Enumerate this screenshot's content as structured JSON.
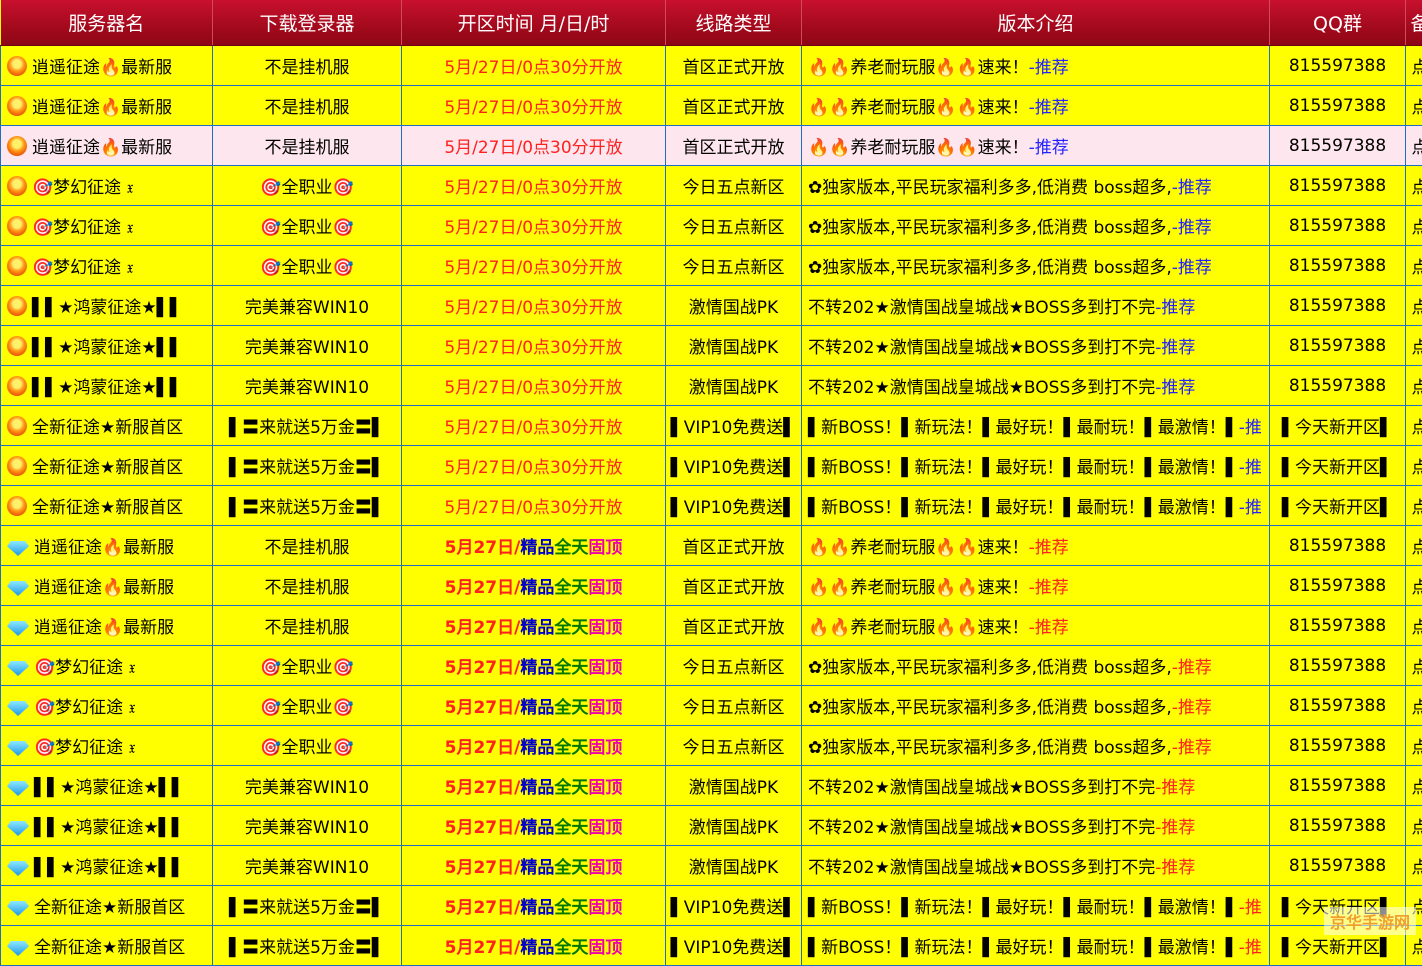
{
  "table": {
    "headers": [
      "服务器名",
      "下载登录器",
      "开区时间 月/日/时",
      "线路类型",
      "版本介绍",
      "QQ群",
      "备"
    ],
    "rows": [
      {
        "icon": "fire-icon",
        "name": "逍遥征途🔥最新服",
        "download": "不是挂机服",
        "open": "5月/27日/0点30分开放",
        "open_style": "a",
        "line": "首区正式开放",
        "desc": "🔥🔥养老耐玩服🔥🔥速来！",
        "rec": "-推荐",
        "rec_style": "b",
        "qq": "815597388",
        "extra": "点",
        "highlight": false
      },
      {
        "icon": "fire-icon",
        "name": "逍遥征途🔥最新服",
        "download": "不是挂机服",
        "open": "5月/27日/0点30分开放",
        "open_style": "a",
        "line": "首区正式开放",
        "desc": "🔥🔥养老耐玩服🔥🔥速来！",
        "rec": "-推荐",
        "rec_style": "b",
        "qq": "815597388",
        "extra": "点",
        "highlight": false
      },
      {
        "icon": "fire-icon",
        "name": "逍遥征途🔥最新服",
        "download": "不是挂机服",
        "open": "5月/27日/0点30分开放",
        "open_style": "a",
        "line": "首区正式开放",
        "desc": "🔥🔥养老耐玩服🔥🔥速来！",
        "rec": "-推荐",
        "rec_style": "b",
        "qq": "815597388",
        "extra": "点",
        "highlight": true
      },
      {
        "icon": "fire-icon",
        "name": "🎯梦幻征途 𝔵",
        "download": "🎯全职业🎯",
        "open": "5月/27日/0点30分开放",
        "open_style": "a",
        "line": "今日五点新区",
        "desc": "✿独家版本,平民玩家福利多多,低消费 boss超多,",
        "rec": "-推荐",
        "rec_style": "b",
        "qq": "815597388",
        "extra": "点",
        "highlight": false
      },
      {
        "icon": "fire-icon",
        "name": "🎯梦幻征途 𝔵",
        "download": "🎯全职业🎯",
        "open": "5月/27日/0点30分开放",
        "open_style": "a",
        "line": "今日五点新区",
        "desc": "✿独家版本,平民玩家福利多多,低消费 boss超多,",
        "rec": "-推荐",
        "rec_style": "b",
        "qq": "815597388",
        "extra": "点",
        "highlight": false
      },
      {
        "icon": "fire-icon",
        "name": "🎯梦幻征途 𝔵",
        "download": "🎯全职业🎯",
        "open": "5月/27日/0点30分开放",
        "open_style": "a",
        "line": "今日五点新区",
        "desc": "✿独家版本,平民玩家福利多多,低消费 boss超多,",
        "rec": "-推荐",
        "rec_style": "b",
        "qq": "815597388",
        "extra": "点",
        "highlight": false
      },
      {
        "icon": "fire-icon",
        "name": "▌▌★鸿蒙征途★▌▌",
        "download": "完美兼容WIN10",
        "open": "5月/27日/0点30分开放",
        "open_style": "a",
        "line": "激情国战PK",
        "desc": "不转202★激情国战皇城战★BOSS多到打不完",
        "rec": "-推荐",
        "rec_style": "b",
        "qq": "815597388",
        "extra": "点",
        "highlight": false
      },
      {
        "icon": "fire-icon",
        "name": "▌▌★鸿蒙征途★▌▌",
        "download": "完美兼容WIN10",
        "open": "5月/27日/0点30分开放",
        "open_style": "a",
        "line": "激情国战PK",
        "desc": "不转202★激情国战皇城战★BOSS多到打不完",
        "rec": "-推荐",
        "rec_style": "b",
        "qq": "815597388",
        "extra": "点",
        "highlight": false
      },
      {
        "icon": "fire-icon",
        "name": "▌▌★鸿蒙征途★▌▌",
        "download": "完美兼容WIN10",
        "open": "5月/27日/0点30分开放",
        "open_style": "a",
        "line": "激情国战PK",
        "desc": "不转202★激情国战皇城战★BOSS多到打不完",
        "rec": "-推荐",
        "rec_style": "b",
        "qq": "815597388",
        "extra": "点",
        "highlight": false
      },
      {
        "icon": "fire-icon",
        "name": "全新征途★新服首区",
        "download": "▌〓来就送5万金〓▌",
        "open": "5月/27日/0点30分开放",
        "open_style": "a",
        "line": "▌VIP10免费送▌",
        "desc": "▌新BOSS！▌新玩法！▌最好玩！▌最耐玩！▌最激情！▌",
        "rec": "-推",
        "rec_style": "b",
        "qq": "▌今天新开区▌",
        "extra": "点",
        "highlight": false
      },
      {
        "icon": "fire-icon",
        "name": "全新征途★新服首区",
        "download": "▌〓来就送5万金〓▌",
        "open": "5月/27日/0点30分开放",
        "open_style": "a",
        "line": "▌VIP10免费送▌",
        "desc": "▌新BOSS！▌新玩法！▌最好玩！▌最耐玩！▌最激情！▌",
        "rec": "-推",
        "rec_style": "b",
        "qq": "▌今天新开区▌",
        "extra": "点",
        "highlight": false
      },
      {
        "icon": "fire-icon",
        "name": "全新征途★新服首区",
        "download": "▌〓来就送5万金〓▌",
        "open": "5月/27日/0点30分开放",
        "open_style": "a",
        "line": "▌VIP10免费送▌",
        "desc": "▌新BOSS！▌新玩法！▌最好玩！▌最耐玩！▌最激情！▌",
        "rec": "-推",
        "rec_style": "b",
        "qq": "▌今天新开区▌",
        "extra": "点",
        "highlight": false
      },
      {
        "icon": "diamond-icon",
        "name": "逍遥征途🔥最新服",
        "download": "不是挂机服",
        "open": [
          "5月27日/",
          "精品",
          "全天",
          "固顶"
        ],
        "open_style": "b",
        "line": "首区正式开放",
        "desc": "🔥🔥养老耐玩服🔥🔥速来！",
        "rec": "-推荐",
        "rec_style": "r",
        "qq": "815597388",
        "extra": "点",
        "highlight": false
      },
      {
        "icon": "diamond-icon",
        "name": "逍遥征途🔥最新服",
        "download": "不是挂机服",
        "open": [
          "5月27日/",
          "精品",
          "全天",
          "固顶"
        ],
        "open_style": "b",
        "line": "首区正式开放",
        "desc": "🔥🔥养老耐玩服🔥🔥速来！",
        "rec": "-推荐",
        "rec_style": "r",
        "qq": "815597388",
        "extra": "点",
        "highlight": false
      },
      {
        "icon": "diamond-icon",
        "name": "逍遥征途🔥最新服",
        "download": "不是挂机服",
        "open": [
          "5月27日/",
          "精品",
          "全天",
          "固顶"
        ],
        "open_style": "b",
        "line": "首区正式开放",
        "desc": "🔥🔥养老耐玩服🔥🔥速来！",
        "rec": "-推荐",
        "rec_style": "r",
        "qq": "815597388",
        "extra": "点",
        "highlight": false
      },
      {
        "icon": "diamond-icon",
        "name": "🎯梦幻征途 𝔵",
        "download": "🎯全职业🎯",
        "open": [
          "5月27日/",
          "精品",
          "全天",
          "固顶"
        ],
        "open_style": "b",
        "line": "今日五点新区",
        "desc": "✿独家版本,平民玩家福利多多,低消费 boss超多,",
        "rec": "-推荐",
        "rec_style": "r",
        "qq": "815597388",
        "extra": "点",
        "highlight": false
      },
      {
        "icon": "diamond-icon",
        "name": "🎯梦幻征途 𝔵",
        "download": "🎯全职业🎯",
        "open": [
          "5月27日/",
          "精品",
          "全天",
          "固顶"
        ],
        "open_style": "b",
        "line": "今日五点新区",
        "desc": "✿独家版本,平民玩家福利多多,低消费 boss超多,",
        "rec": "-推荐",
        "rec_style": "r",
        "qq": "815597388",
        "extra": "点",
        "highlight": false
      },
      {
        "icon": "diamond-icon",
        "name": "🎯梦幻征途 𝔵",
        "download": "🎯全职业🎯",
        "open": [
          "5月27日/",
          "精品",
          "全天",
          "固顶"
        ],
        "open_style": "b",
        "line": "今日五点新区",
        "desc": "✿独家版本,平民玩家福利多多,低消费 boss超多,",
        "rec": "-推荐",
        "rec_style": "r",
        "qq": "815597388",
        "extra": "点",
        "highlight": false
      },
      {
        "icon": "diamond-icon",
        "name": "▌▌★鸿蒙征途★▌▌",
        "download": "完美兼容WIN10",
        "open": [
          "5月27日/",
          "精品",
          "全天",
          "固顶"
        ],
        "open_style": "b",
        "line": "激情国战PK",
        "desc": "不转202★激情国战皇城战★BOSS多到打不完",
        "rec": "-推荐",
        "rec_style": "r",
        "qq": "815597388",
        "extra": "点",
        "highlight": false
      },
      {
        "icon": "diamond-icon",
        "name": "▌▌★鸿蒙征途★▌▌",
        "download": "完美兼容WIN10",
        "open": [
          "5月27日/",
          "精品",
          "全天",
          "固顶"
        ],
        "open_style": "b",
        "line": "激情国战PK",
        "desc": "不转202★激情国战皇城战★BOSS多到打不完",
        "rec": "-推荐",
        "rec_style": "r",
        "qq": "815597388",
        "extra": "点",
        "highlight": false
      },
      {
        "icon": "diamond-icon",
        "name": "▌▌★鸿蒙征途★▌▌",
        "download": "完美兼容WIN10",
        "open": [
          "5月27日/",
          "精品",
          "全天",
          "固顶"
        ],
        "open_style": "b",
        "line": "激情国战PK",
        "desc": "不转202★激情国战皇城战★BOSS多到打不完",
        "rec": "-推荐",
        "rec_style": "r",
        "qq": "815597388",
        "extra": "点",
        "highlight": false
      },
      {
        "icon": "diamond-icon",
        "name": "全新征途★新服首区",
        "download": "▌〓来就送5万金〓▌",
        "open": [
          "5月27日/",
          "精品",
          "全天",
          "固顶"
        ],
        "open_style": "b",
        "line": "▌VIP10免费送▌",
        "desc": "▌新BOSS！▌新玩法！▌最好玩！▌最耐玩！▌最激情！▌",
        "rec": "-推",
        "rec_style": "r",
        "qq": "▌今天新开区▌",
        "extra": "点",
        "highlight": false
      },
      {
        "icon": "diamond-icon",
        "name": "全新征途★新服首区",
        "download": "▌〓来就送5万金〓▌",
        "open": [
          "5月27日/",
          "精品",
          "全天",
          "固顶"
        ],
        "open_style": "b",
        "line": "▌VIP10免费送▌",
        "desc": "▌新BOSS！▌新玩法！▌最好玩！▌最耐玩！▌最激情！▌",
        "rec": "-推",
        "rec_style": "r",
        "qq": "▌今天新开区▌",
        "extra": "点",
        "highlight": false
      }
    ]
  },
  "watermark": "京华手游网"
}
